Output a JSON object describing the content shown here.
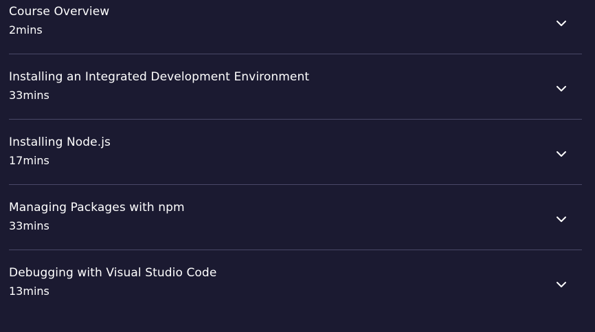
{
  "modules": [
    {
      "title": "Course Overview",
      "duration": "2mins",
      "toggle_icon": "chevron-down-icon"
    },
    {
      "title": "Installing an Integrated Development Environment",
      "duration": "33mins",
      "toggle_icon": "chevron-down-icon"
    },
    {
      "title": "Installing Node.js",
      "duration": "17mins",
      "toggle_icon": "chevron-down-icon"
    },
    {
      "title": "Managing Packages with npm",
      "duration": "33mins",
      "toggle_icon": "chevron-down-icon"
    },
    {
      "title": "Debugging with Visual Studio Code",
      "duration": "13mins",
      "toggle_icon": "chevron-down-icon"
    }
  ]
}
